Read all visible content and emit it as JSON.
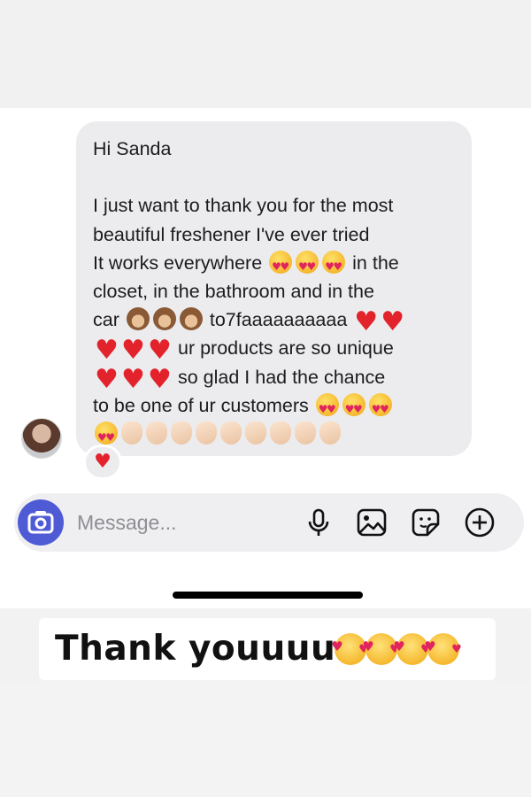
{
  "conversation": {
    "message_lines": [
      "Hi Sanda",
      "",
      "I just want to thank you for the most",
      "beautiful freshener I've ever tried",
      "It works everywhere",
      "in the",
      "closet, in the bathroom and in the",
      "car",
      "to7faaaaaaaaaa",
      "ur products are so unique",
      "so glad I had the chance",
      "to be one of ur customers"
    ],
    "reaction": "heart"
  },
  "composer": {
    "placeholder": "Message...",
    "icons": [
      "camera-icon",
      "microphone-icon",
      "gallery-icon",
      "sticker-icon",
      "add-icon"
    ]
  },
  "caption": {
    "text": "Thank youuuu",
    "emoji": "smiling-face-with-hearts",
    "emoji_count": 4
  },
  "colors": {
    "bubble": "#ececee",
    "camera_button": "#4f5bd5",
    "heart": "#e3232c"
  }
}
